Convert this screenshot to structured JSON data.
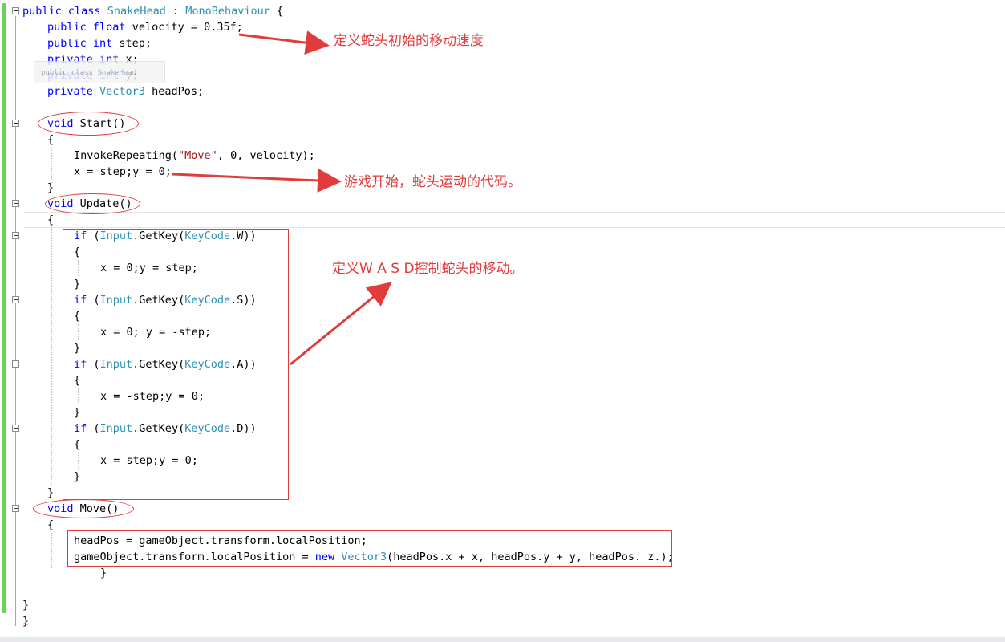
{
  "code": {
    "lines": [
      {
        "t": [
          [
            "public ",
            "kw"
          ],
          [
            "class ",
            "kw"
          ],
          [
            "SnakeHead",
            "ty"
          ],
          [
            " : ",
            "pl"
          ],
          [
            "MonoBehaviour",
            "ty"
          ],
          [
            " {",
            "pl"
          ]
        ]
      },
      {
        "t": [
          [
            "public ",
            "kw"
          ],
          [
            "float ",
            "kw"
          ],
          [
            "velocity = 0.35f;",
            "pl"
          ]
        ]
      },
      {
        "t": [
          [
            "public ",
            "kw"
          ],
          [
            "int ",
            "kw"
          ],
          [
            "step;",
            "pl"
          ]
        ]
      },
      {
        "t": [
          [
            "private ",
            "kw"
          ],
          [
            "int ",
            "kw"
          ],
          [
            "x;",
            "pl"
          ]
        ]
      },
      {
        "t": [
          [
            "private ",
            "kw"
          ],
          [
            "int ",
            "kw"
          ],
          [
            "y;",
            "pl"
          ]
        ]
      },
      {
        "t": [
          [
            "private ",
            "kw"
          ],
          [
            "Vector3",
            "ty"
          ],
          [
            " headPos;",
            "pl"
          ]
        ]
      },
      {
        "t": []
      },
      {
        "t": [
          [
            "void ",
            "kw"
          ],
          [
            "Start()",
            "pl"
          ]
        ]
      },
      {
        "t": [
          [
            "{",
            "pl"
          ]
        ]
      },
      {
        "t": [
          [
            "InvokeRepeating(",
            "pl"
          ],
          [
            "\"Move\"",
            "st"
          ],
          [
            ", 0, velocity);",
            "pl"
          ]
        ]
      },
      {
        "t": [
          [
            "x = step;y = 0;",
            "pl"
          ]
        ]
      },
      {
        "t": [
          [
            "}",
            "pl"
          ]
        ]
      },
      {
        "t": [
          [
            "void ",
            "kw"
          ],
          [
            "Update()",
            "pl"
          ]
        ]
      },
      {
        "t": [
          [
            "{",
            "pl"
          ]
        ]
      },
      {
        "t": [
          [
            "if ",
            "kw"
          ],
          [
            "(",
            "pl"
          ],
          [
            "Input",
            "ty"
          ],
          [
            ".GetKey(",
            "pl"
          ],
          [
            "KeyCode",
            "ty"
          ],
          [
            ".W))",
            "pl"
          ]
        ]
      },
      {
        "t": [
          [
            "{",
            "pl"
          ]
        ]
      },
      {
        "t": [
          [
            "x = 0;y = step;",
            "pl"
          ]
        ]
      },
      {
        "t": [
          [
            "}",
            "pl"
          ]
        ]
      },
      {
        "t": [
          [
            "if ",
            "kw"
          ],
          [
            "(",
            "pl"
          ],
          [
            "Input",
            "ty"
          ],
          [
            ".GetKey(",
            "pl"
          ],
          [
            "KeyCode",
            "ty"
          ],
          [
            ".S))",
            "pl"
          ]
        ]
      },
      {
        "t": [
          [
            "{",
            "pl"
          ]
        ]
      },
      {
        "t": [
          [
            "x = 0; y = -step;",
            "pl"
          ]
        ]
      },
      {
        "t": [
          [
            "}",
            "pl"
          ]
        ]
      },
      {
        "t": [
          [
            "if ",
            "kw"
          ],
          [
            "(",
            "pl"
          ],
          [
            "Input",
            "ty"
          ],
          [
            ".GetKey(",
            "pl"
          ],
          [
            "KeyCode",
            "ty"
          ],
          [
            ".A))",
            "pl"
          ]
        ]
      },
      {
        "t": [
          [
            "{",
            "pl"
          ]
        ]
      },
      {
        "t": [
          [
            "x = -step;y = 0;",
            "pl"
          ]
        ]
      },
      {
        "t": [
          [
            "}",
            "pl"
          ]
        ]
      },
      {
        "t": [
          [
            "if ",
            "kw"
          ],
          [
            "(",
            "pl"
          ],
          [
            "Input",
            "ty"
          ],
          [
            ".GetKey(",
            "pl"
          ],
          [
            "KeyCode",
            "ty"
          ],
          [
            ".D))",
            "pl"
          ]
        ]
      },
      {
        "t": [
          [
            "{",
            "pl"
          ]
        ]
      },
      {
        "t": [
          [
            "x = step;y = 0;",
            "pl"
          ]
        ]
      },
      {
        "t": [
          [
            "}",
            "pl"
          ]
        ]
      },
      {
        "t": [
          [
            "}",
            "pl"
          ]
        ]
      },
      {
        "t": [
          [
            "void ",
            "kw"
          ],
          [
            "Move()",
            "pl"
          ]
        ]
      },
      {
        "t": [
          [
            "{",
            "pl"
          ]
        ]
      },
      {
        "t": [
          [
            "headPos = gameObject.transform.localPosition;",
            "pl"
          ]
        ]
      },
      {
        "t": [
          [
            "gameObject.transform.localPosition = ",
            "pl"
          ],
          [
            "new ",
            "kw"
          ],
          [
            "Vector3",
            "ty"
          ],
          [
            "(headPos.x + x, headPos.y + y, headPos. z.);",
            "pl"
          ]
        ]
      },
      {
        "t": [
          [
            "}",
            "pl"
          ]
        ]
      },
      {
        "t": []
      },
      {
        "t": [
          [
            "}",
            "pl"
          ]
        ]
      },
      {
        "t": [
          [
            "}",
            "pl"
          ]
        ]
      }
    ]
  },
  "tooltip": "public class SnakeHead",
  "annotations": {
    "velocity_note": "定义蛇头初始的移动速度",
    "start_note": "游戏开始，蛇头运动的代码。",
    "wasd_note": "定义W A S D控制蛇头的移动。"
  },
  "colors": {
    "annotation": "#e03c3c",
    "keyword": "#0000ff",
    "type": "#2b91af",
    "string": "#a31515",
    "change_bar": "#6ad45a"
  }
}
